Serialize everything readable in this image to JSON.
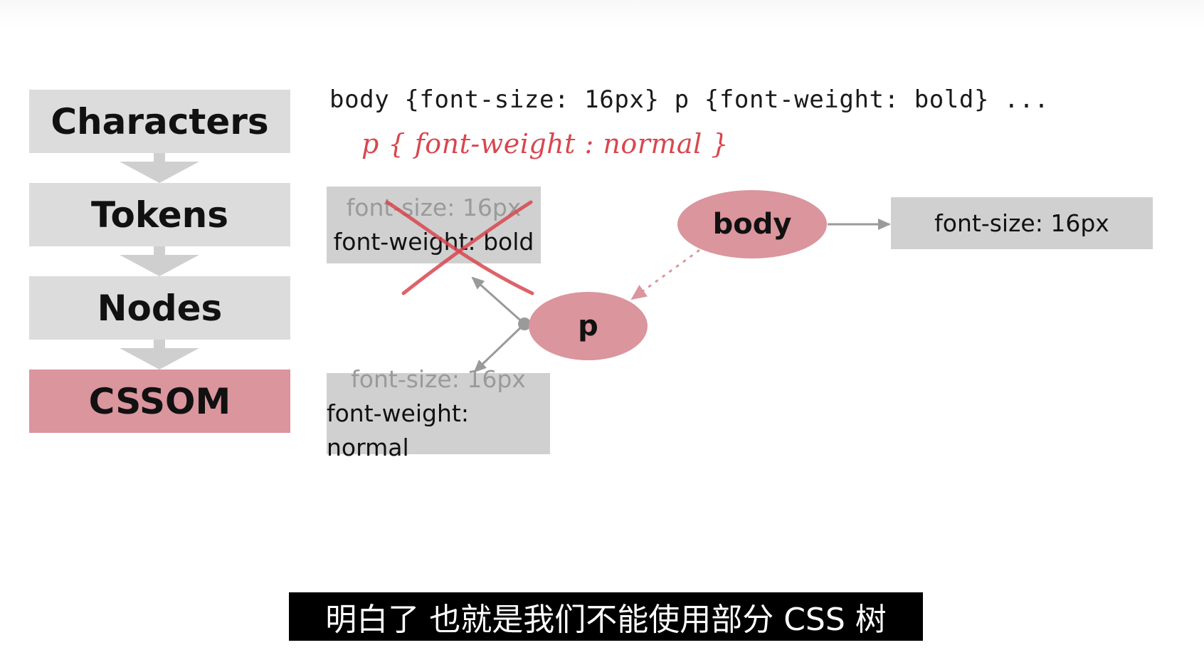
{
  "pipeline": {
    "steps": [
      {
        "label": "Characters",
        "active": false
      },
      {
        "label": "Tokens",
        "active": false
      },
      {
        "label": "Nodes",
        "active": false
      },
      {
        "label": "CSSOM",
        "active": true
      }
    ]
  },
  "code": {
    "line": "body {font-size: 16px} p {font-weight: bold} ...",
    "handwritten_annotation": "p { font-weight : normal }"
  },
  "tree": {
    "nodes": {
      "body": {
        "label": "body"
      },
      "p": {
        "label": "p"
      }
    },
    "body_styles": {
      "line1": "font-size: 16px"
    },
    "p_styles_crossed": {
      "inherited": "font-size: 16px",
      "own": "font-weight: bold",
      "crossed_out": true
    },
    "p_styles_new": {
      "inherited": "font-size: 16px",
      "own": "font-weight: normal"
    }
  },
  "colors": {
    "node_pink": "#da959d",
    "box_gray": "#d0d0d0",
    "annotation_red": "#d8474f",
    "arrow_gray": "#9a9a9a"
  },
  "subtitle": {
    "text": "明白了 也就是我们不能使用部分 CSS 树"
  }
}
